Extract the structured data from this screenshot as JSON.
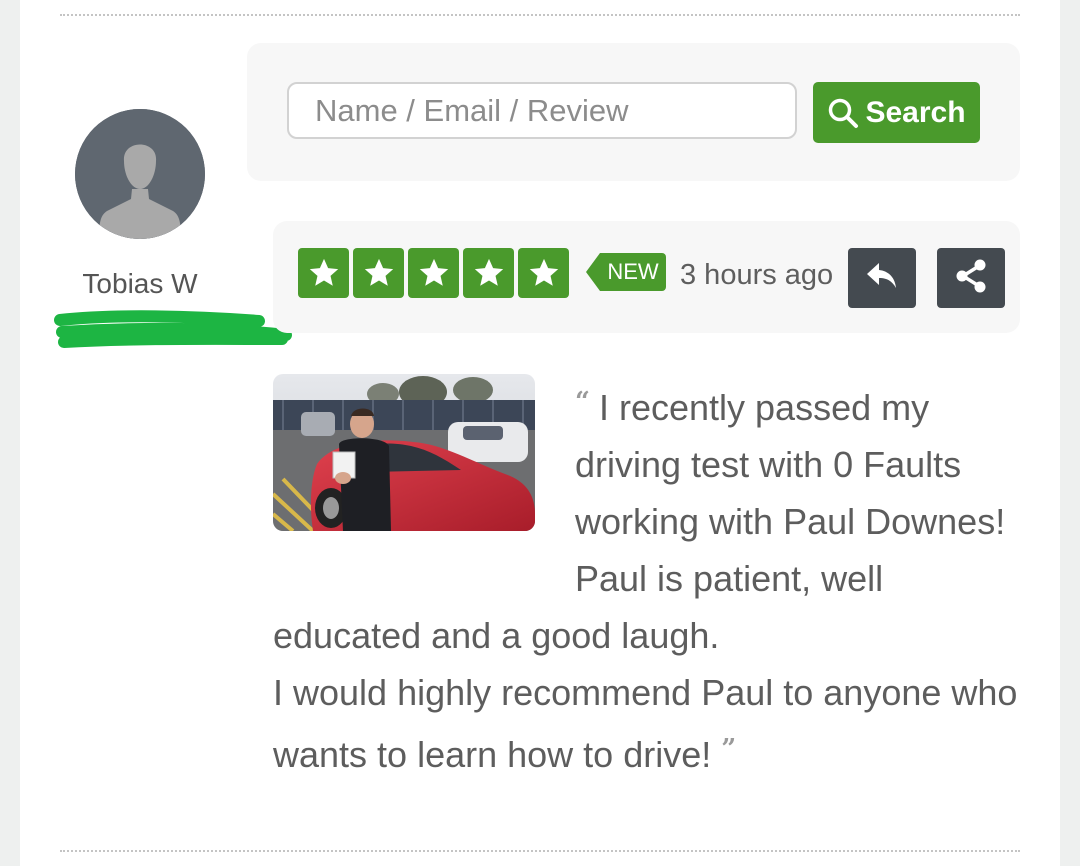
{
  "search": {
    "placeholder": "Name / Email / Review",
    "button_label": "Search",
    "button_icon": "search-icon",
    "button_color": "#4a9a2c"
  },
  "reviewer": {
    "name": "Tobias W",
    "avatar_icon": "default-user-avatar",
    "redaction_color": "#1db543"
  },
  "review": {
    "rating": 5,
    "max_rating": 5,
    "star_color": "#4a9a2c",
    "badge": "NEW",
    "time_ago": "3 hours ago",
    "open_quote": "“",
    "close_quote": "”",
    "text_line1": "I recently passed my driving test with 0 Faults working with Paul Downes! Paul is patient, well educated and a good laugh.",
    "text_line2": "I would highly recommend Paul to anyone who wants to learn how to drive!",
    "actions": {
      "reply_icon": "reply-icon",
      "share_icon": "share-icon",
      "button_color": "#444a50"
    }
  }
}
